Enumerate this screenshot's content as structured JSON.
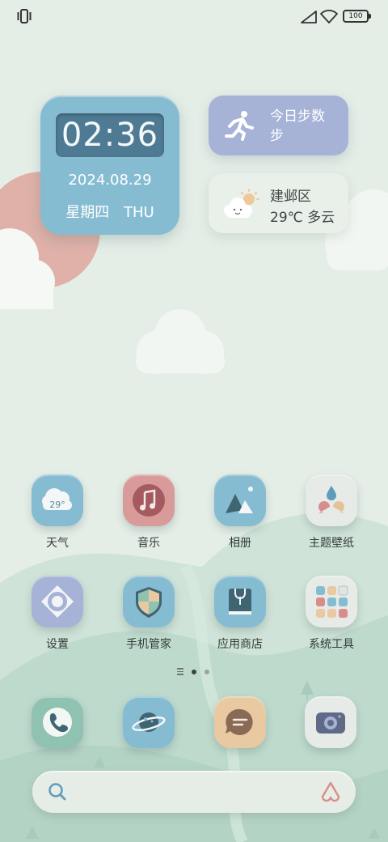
{
  "status_bar": {
    "battery": "100"
  },
  "clock": {
    "time": "02:36",
    "date": "2024.08.29",
    "weekday_cn": "星期四",
    "weekday_en": "THU"
  },
  "steps": {
    "label": "今日步数\n步"
  },
  "weather": {
    "location": "建邺区",
    "condition": "29℃ 多云",
    "icon_temp": "29°"
  },
  "apps": [
    {
      "label": "天气",
      "icon": "weather-icon"
    },
    {
      "label": "音乐",
      "icon": "music-icon"
    },
    {
      "label": "相册",
      "icon": "gallery-icon"
    },
    {
      "label": "主题壁纸",
      "icon": "themes-icon"
    },
    {
      "label": "设置",
      "icon": "settings-icon"
    },
    {
      "label": "手机管家",
      "icon": "shield-icon"
    },
    {
      "label": "应用商店",
      "icon": "app-store-icon"
    },
    {
      "label": "系统工具",
      "icon": "tools-folder-icon"
    }
  ],
  "dock": [
    {
      "icon": "phone-icon"
    },
    {
      "icon": "browser-icon"
    },
    {
      "icon": "messages-icon"
    },
    {
      "icon": "camera-icon"
    }
  ],
  "page_indicator": {
    "pages": 2,
    "current": 1
  },
  "colors": {
    "background": "#e3ede6",
    "clock_widget": "#86bcd2",
    "steps_widget": "#a6b3d6",
    "weather_app": "#86bcd2",
    "music_app": "#d99a9a",
    "gallery_app": "#86bcd2",
    "settings_app": "#a6b3d6",
    "phone_app": "#8fc2b0",
    "messages_app": "#e8c9a1"
  }
}
